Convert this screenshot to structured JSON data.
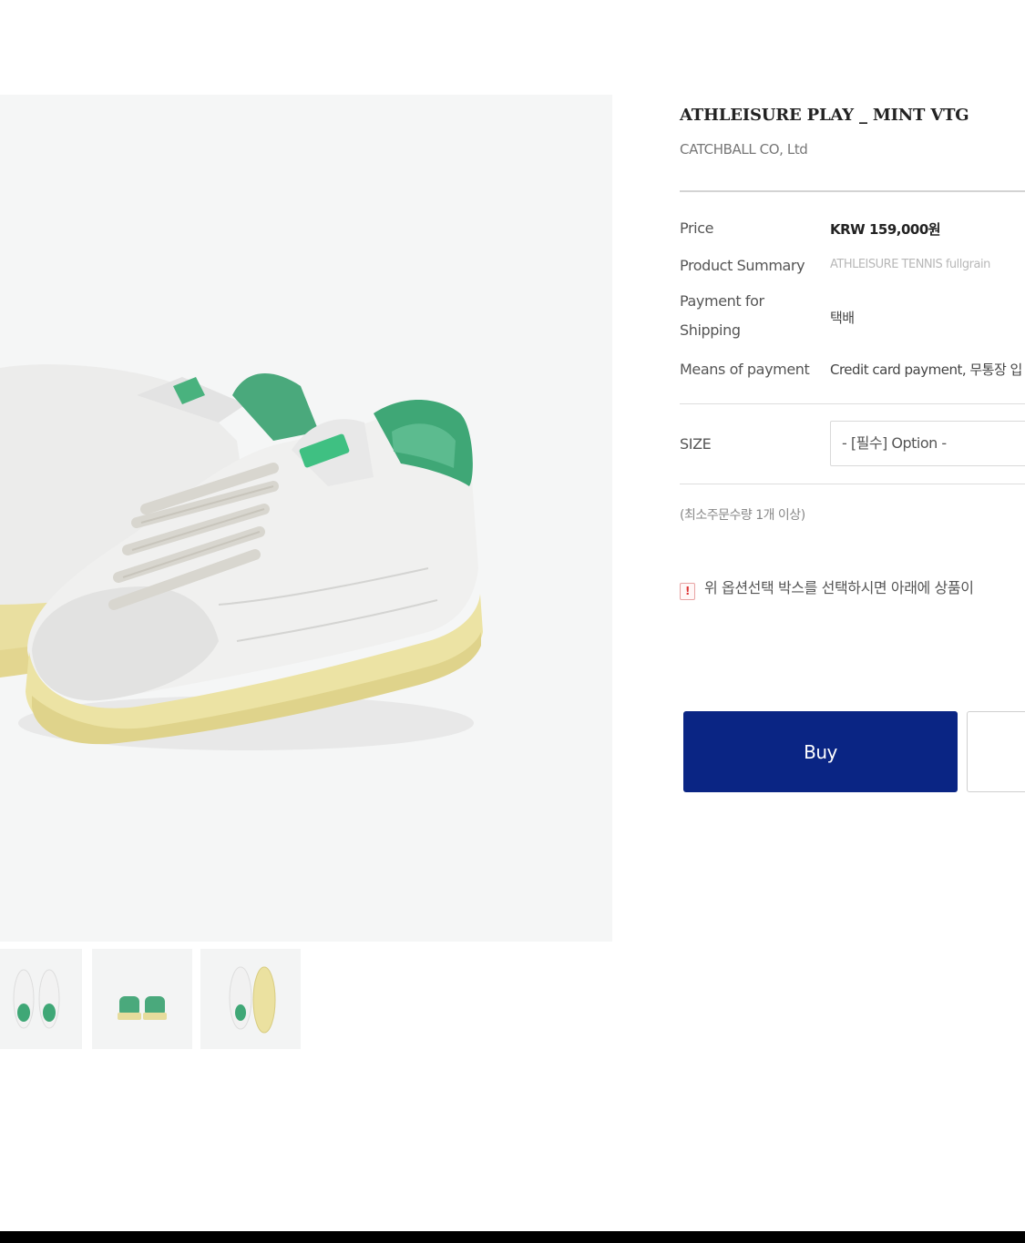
{
  "product": {
    "title": "ATHLEISURE PLAY _ MINT VTG",
    "brand": "CATCHBALL CO, Ltd"
  },
  "details": {
    "price_label": "Price",
    "price_value": "KRW 159,000원",
    "summary_label": "Product Summary",
    "summary_value": "ATHLEISURE TENNIS fullgrain",
    "shipping_label_line1": "Payment for",
    "shipping_label_line2": "Shipping",
    "shipping_value": "택배",
    "payment_label": "Means of payment",
    "payment_value": "Credit card payment, 무통장 입"
  },
  "options": {
    "size_label": "SIZE",
    "size_selected": "- [필수] Option -",
    "min_order": "(최소주문수량 1개 이상)",
    "notice_icon": "!",
    "notice_text": "위 옵션선택 박스를 선택하시면 아래에 상품이"
  },
  "actions": {
    "buy_label": "Buy"
  },
  "gallery": {
    "thumbnails": [
      "sneaker-top-view",
      "sneaker-back-view",
      "sneaker-sole-view"
    ]
  },
  "colors": {
    "buy_button": "#0a2584",
    "mint_accent": "#3fa776",
    "sole": "#ece3a4"
  }
}
